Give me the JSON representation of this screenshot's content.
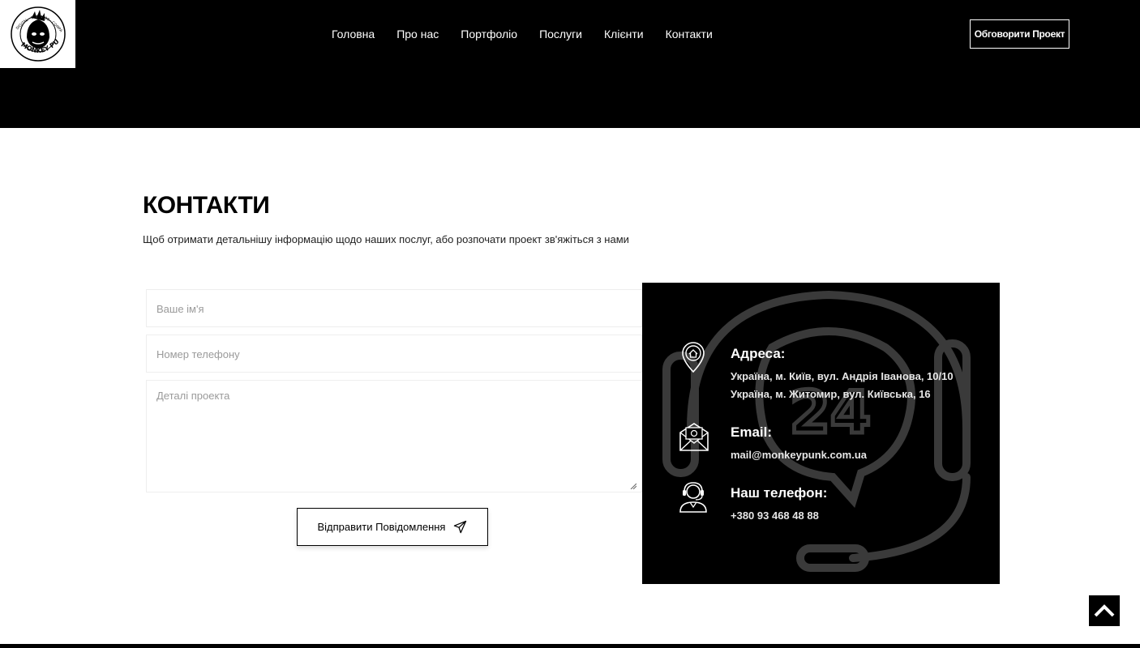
{
  "logo": {
    "icon": "monkey-punk-logo",
    "text": "MONKEY PUNK",
    "ring_text": "DIGITAL · EST. 2020 · COMPANY"
  },
  "nav": {
    "items": [
      "Головна",
      "Про нас",
      "Портфоліо",
      "Послуги",
      "Клієнти",
      "Контакти"
    ],
    "cta_label": "Обговорити Проект"
  },
  "contacts": {
    "title": "КОНТАКТИ",
    "subtitle": "Щоб отримати детальнішу інформацію щодо наших послуг, або розпочати проект зв'яжіться з нами"
  },
  "form": {
    "name_placeholder": "Ваше ім'я",
    "phone_placeholder": "Номер телефону",
    "details_placeholder": "Деталі проекта",
    "submit_label": "Відправити Повідомлення",
    "submit_icon": "paper-plane-icon"
  },
  "info": {
    "background_icon": "headset-24-icon",
    "address_label": "Адреса:",
    "address_lines": [
      "Україна, м. Київ, вул. Андрія Іванова, 10/10",
      "Україна, м. Житомир, вул. Київська, 16"
    ],
    "email_label": "Email:",
    "email_value": "mail@monkeypunk.com.ua",
    "phone_label": "Наш телефон:",
    "phone_value": "+380 93 468 48 88"
  },
  "scroll_top_icon": "chevron-up-icon",
  "colors": {
    "header_bg": "#000000",
    "page_bg": "#ffffff",
    "panel_bg": "#000000",
    "panel_art": "#3a3a3a",
    "placeholder": "#9a9a9a"
  }
}
